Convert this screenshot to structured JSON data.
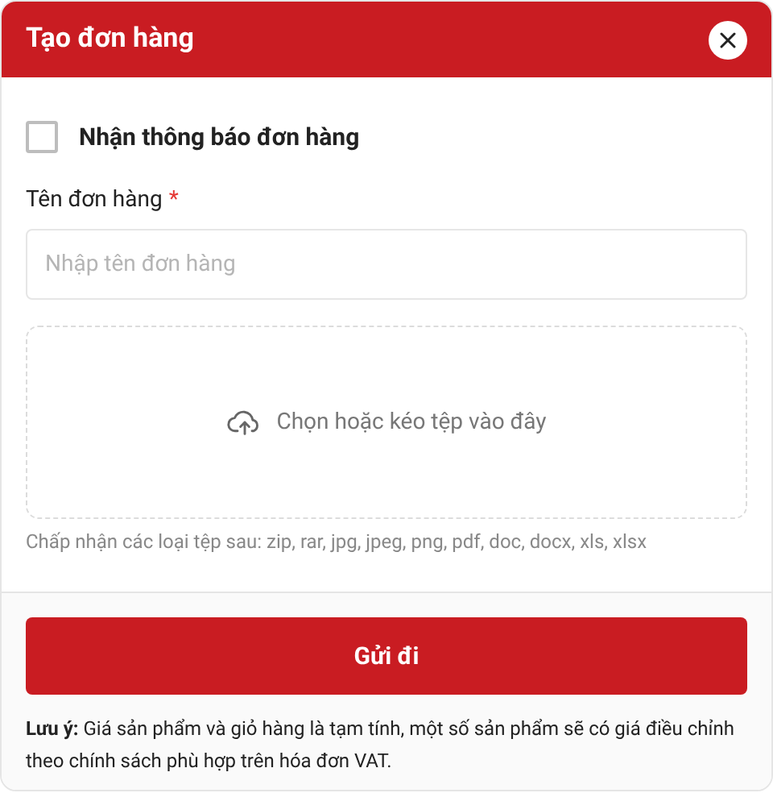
{
  "dialog": {
    "title": "Tạo đơn hàng"
  },
  "notify_checkbox": {
    "label": "Nhận thông báo đơn hàng",
    "checked": false
  },
  "order_name": {
    "label": "Tên đơn hàng",
    "required": true,
    "required_mark": "*",
    "placeholder": "Nhập tên đơn hàng"
  },
  "dropzone": {
    "text": "Chọn hoặc kéo tệp vào đây",
    "hint": "Chấp nhận các loại tệp sau: zip, rar, jpg, jpeg, png, pdf, doc, docx, xls, xlsx"
  },
  "submit_button": "Gửi đi",
  "note": "**Lưu ý:** Giá sản phẩm và giỏ hàng là tạm tính, một số sản phẩm sẽ có giá điều chỉnh theo chính sách phù hợp trên hóa đơn VAT."
}
